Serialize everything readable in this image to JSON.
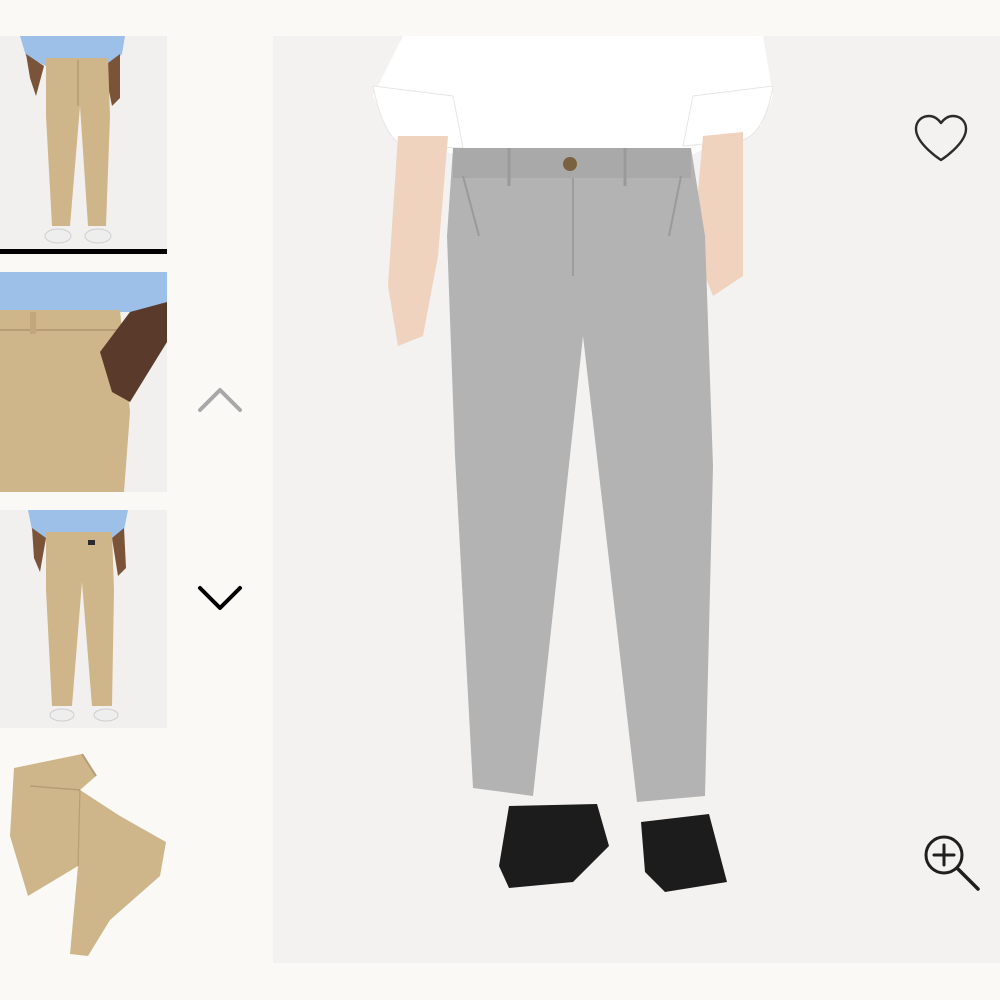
{
  "gallery": {
    "thumbnails": [
      {
        "alt": "model-front-view",
        "color": "khaki"
      },
      {
        "alt": "pocket-detail-view",
        "color": "khaki"
      },
      {
        "alt": "model-back-view",
        "color": "khaki"
      },
      {
        "alt": "flat-lay-view",
        "color": "khaki"
      }
    ],
    "active_index": 0,
    "scroll_up_icon": "chevron-up-icon",
    "scroll_down_icon": "chevron-down-icon"
  },
  "main_image": {
    "alt": "model-wearing-grey-chino-pants",
    "color": "grey",
    "wishlist_icon": "heart-icon",
    "zoom_icon": "zoom-in-icon"
  },
  "colors": {
    "background": "#faf9f6",
    "khaki": "#cfb58a",
    "grey": "#b3b3b3",
    "shirt_blue": "#9cc0e8",
    "active_indicator": "#000000",
    "inactive_arrow": "#a8a8a8"
  }
}
